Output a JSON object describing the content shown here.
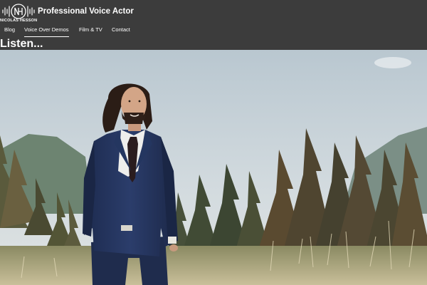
{
  "brand": {
    "logo_icon": "nh-monogram-soundwave-icon",
    "logo_text": "NICOLAS HESSON",
    "site_title": "Professional Voice Actor"
  },
  "nav": {
    "items": [
      {
        "label": "Blog"
      },
      {
        "label": "Voice Over Demos",
        "active": true
      },
      {
        "label": "Film & TV"
      },
      {
        "label": "Contact"
      }
    ]
  },
  "page": {
    "heading": "Listen..."
  },
  "hero": {
    "image": "portrait-man-in-navy-suit-in-meadow-with-pine-forest"
  },
  "colors": {
    "header_bg": "#3c3c3c",
    "text": "#ffffff",
    "suit": "#25345a"
  }
}
